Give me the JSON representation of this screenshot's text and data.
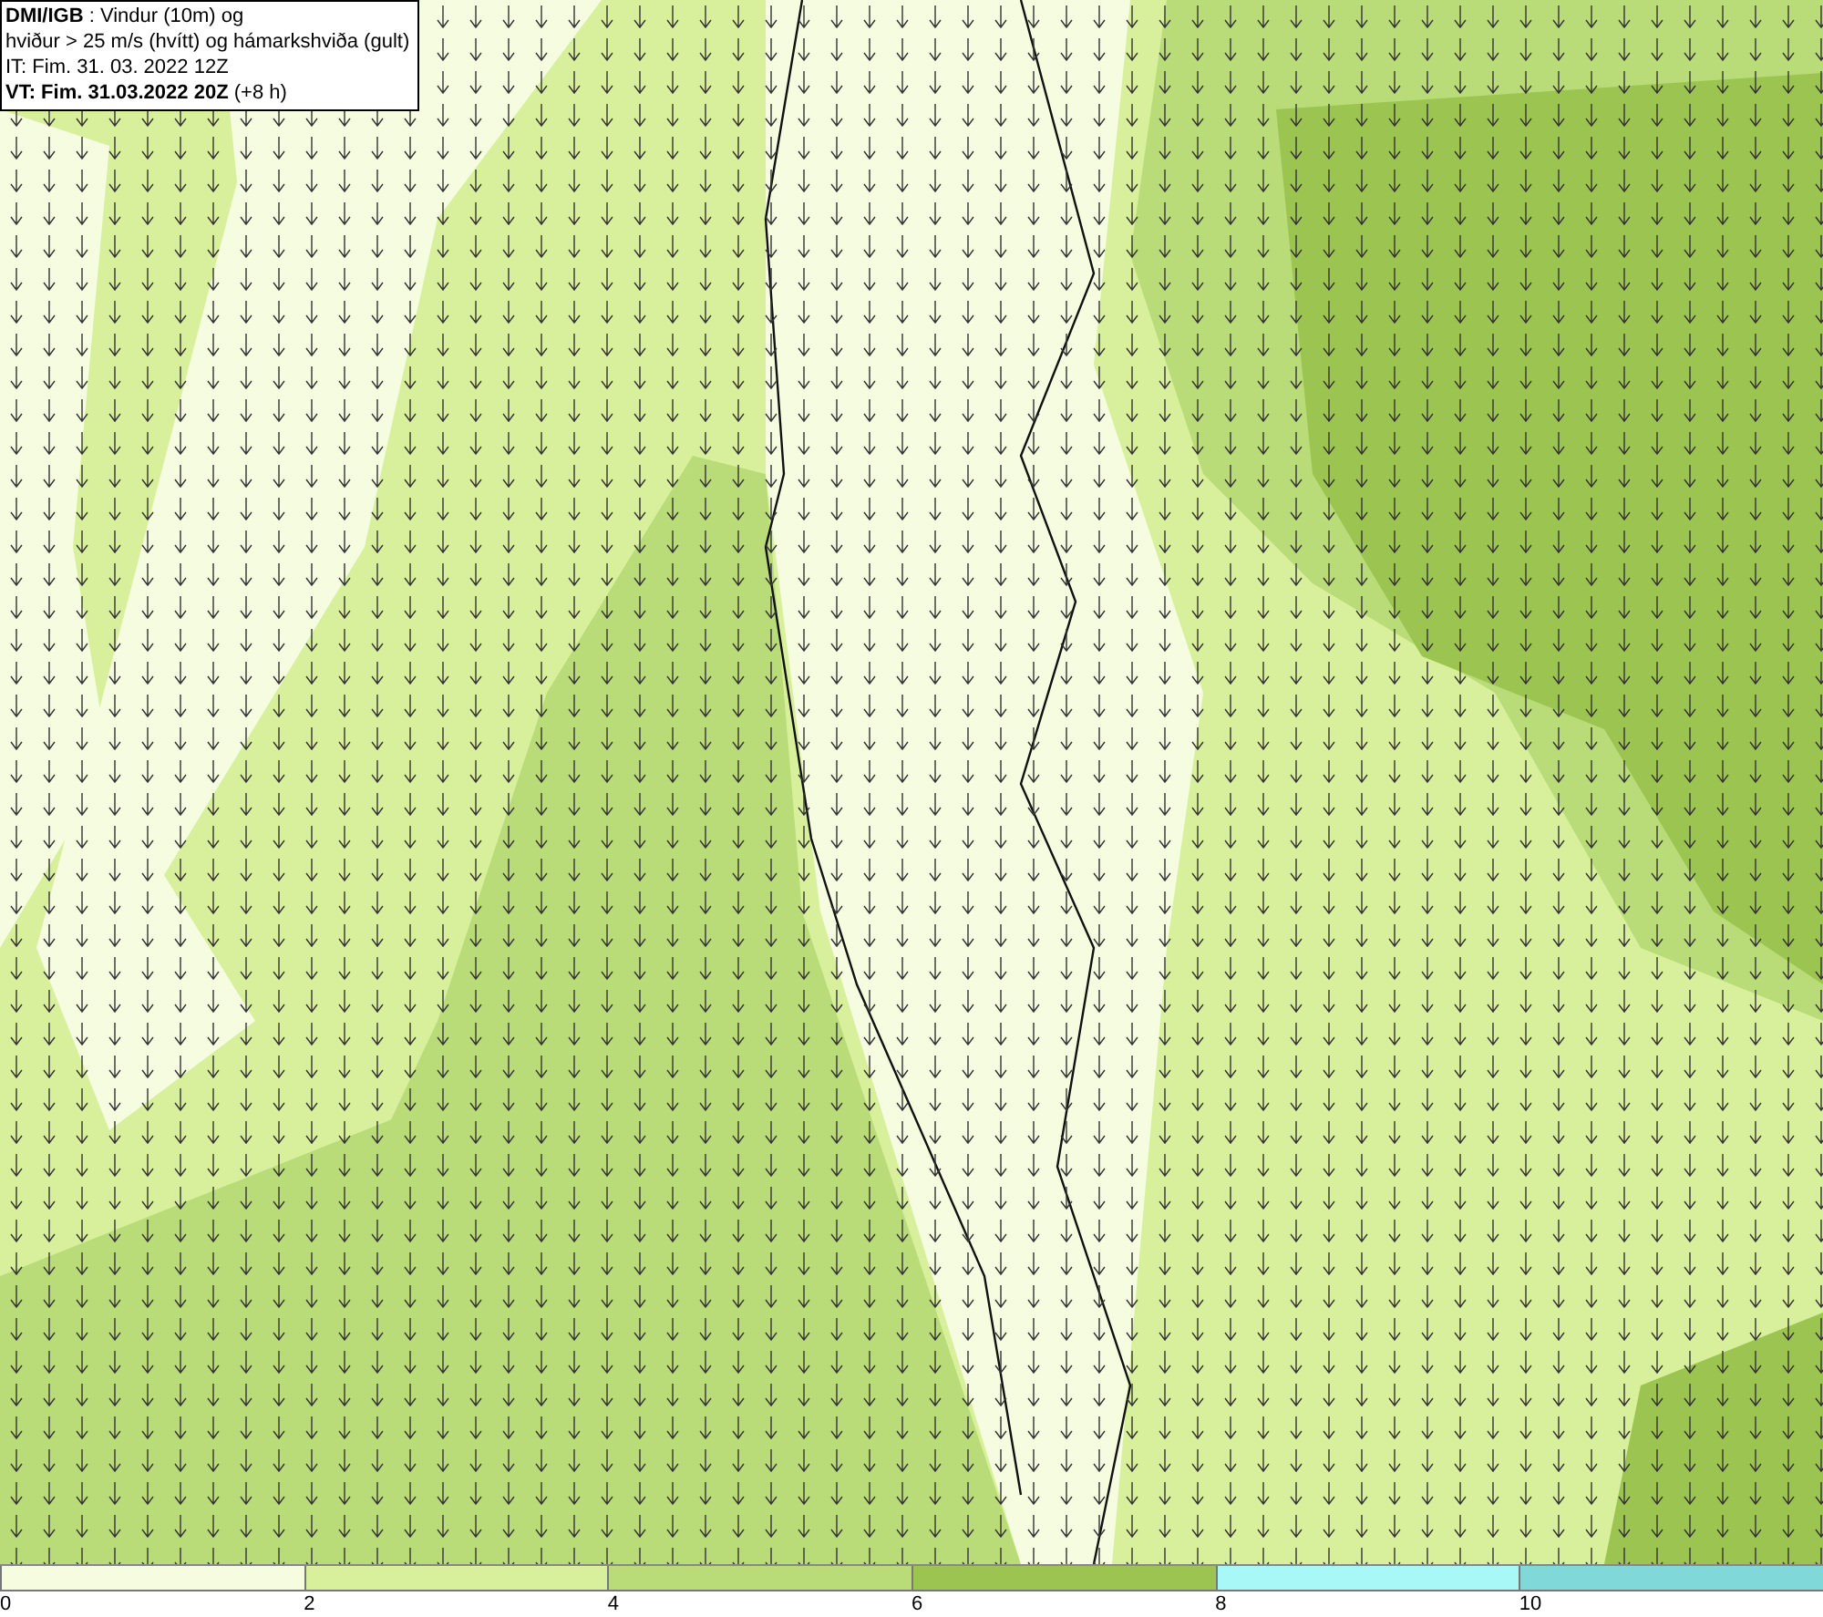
{
  "info_box": {
    "lines": [
      "**DMI/IGB** : Vindur (10m) og",
      "hviður > 25 m/s (hvítt) og hámarkshviða (gult)",
      "IT: Fim. 31. 03. 2022 12Z",
      "**VT: Fim. 31.03.2022 20Z** (+8 h)"
    ]
  },
  "legend": [
    {
      "label": "0",
      "color": "#f5fce0"
    },
    {
      "label": "2",
      "color": "#d8f09c"
    },
    {
      "label": "4",
      "color": "#b9dc78"
    },
    {
      "label": "6",
      "color": "#9cc450"
    },
    {
      "label": "8",
      "color": "#a8f8f8"
    },
    {
      "label": "10",
      "color": "#80d8d8"
    }
  ]
}
